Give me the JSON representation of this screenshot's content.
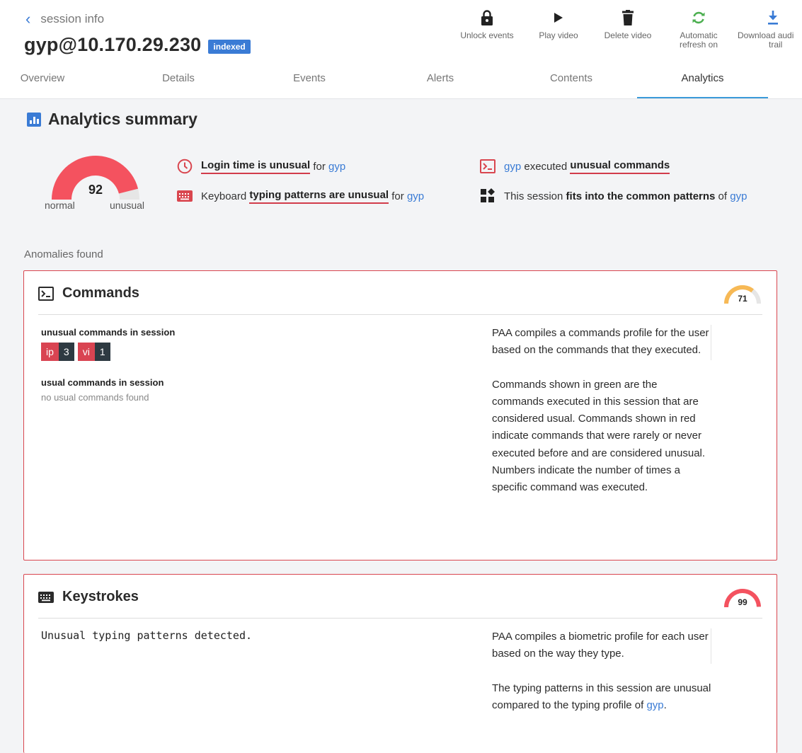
{
  "header": {
    "back_label": "session info",
    "title": "gyp@10.170.29.230",
    "badge": "indexed"
  },
  "toolbar": [
    {
      "icon": "lock-icon",
      "label": "Unlock events"
    },
    {
      "icon": "play-icon",
      "label": "Play video"
    },
    {
      "icon": "trash-icon",
      "label": "Delete video"
    },
    {
      "icon": "refresh-icon",
      "label_line1": "Automatic",
      "label_line2": "refresh on"
    },
    {
      "icon": "download-icon",
      "label_line1": "Download audi",
      "label_line2": "trail"
    }
  ],
  "tabs": [
    "Overview",
    "Details",
    "Events",
    "Alerts",
    "Contents",
    "Analytics"
  ],
  "active_tab": "Analytics",
  "summary": {
    "title": "Analytics summary",
    "score": "92",
    "score_value": 92,
    "gauge_left_label": "normal",
    "gauge_right_label": "unusual",
    "findings": {
      "login": {
        "strong": "Login time is unusual",
        "mid": " for ",
        "user": "gyp"
      },
      "typing": {
        "pre": "Keyboard ",
        "strong": "typing patterns are unusual",
        "mid": " for ",
        "user": "gyp"
      },
      "commands": {
        "user": "gyp",
        "mid": " executed ",
        "strong": "unusual commands"
      },
      "patterns": {
        "pre": "This session ",
        "strong": "fits into the common patterns",
        "mid": " of ",
        "user": "gyp"
      }
    }
  },
  "anomalies_label": "Anomalies found",
  "commands_card": {
    "title": "Commands",
    "score": "71",
    "score_value": 71,
    "unusual_heading": "unusual commands in session",
    "unusual_commands": [
      {
        "name": "ip",
        "count": "3"
      },
      {
        "name": "vi",
        "count": "1"
      }
    ],
    "usual_heading": "usual commands in session",
    "usual_empty": "no usual commands found",
    "desc_p1": "PAA compiles a commands profile for the user based on the commands that they executed.",
    "desc_p2": "Commands shown in green are the commands executed in this session that are considered usual. Commands shown in red indicate commands that were rarely or never executed before and are considered unusual. Numbers indicate the number of times a specific command was executed."
  },
  "keystrokes_card": {
    "title": "Keystrokes",
    "score": "99",
    "score_value": 99,
    "message": "Unusual typing patterns detected.",
    "desc_p1": "PAA compiles a biometric profile for each user based on the way they type.",
    "desc_p2_pre": "The typing patterns in this session are unusual compared to the typing profile of ",
    "desc_p2_user": "gyp",
    "desc_p2_post": "."
  },
  "colors": {
    "accent": "#3a7bd5",
    "alert_red": "#d9464f",
    "gauge_red": "#f4525f",
    "gauge_orange": "#f7b955",
    "refresh_green": "#4caf50"
  }
}
